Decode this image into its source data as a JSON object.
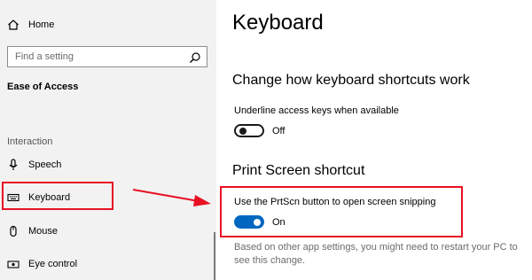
{
  "sidebar": {
    "home_label": "Home",
    "search_placeholder": "Find a setting",
    "section_title": "Ease of Access",
    "group_label": "Interaction",
    "items": [
      {
        "label": "Speech",
        "icon": "microphone-icon"
      },
      {
        "label": "Keyboard",
        "icon": "keyboard-icon"
      },
      {
        "label": "Mouse",
        "icon": "mouse-icon"
      },
      {
        "label": "Eye control",
        "icon": "eye-icon"
      }
    ]
  },
  "main": {
    "title": "Keyboard",
    "shortcuts_heading": "Change how keyboard shortcuts work",
    "underline_label": "Underline access keys when available",
    "underline_state": "Off",
    "printscreen_heading": "Print Screen shortcut",
    "prtscn_label": "Use the PrtScn button to open screen snipping",
    "prtscn_state": "On",
    "note": "Based on other app settings, you might need to restart your PC to see this change."
  },
  "colors": {
    "accent": "#0067c0",
    "highlight": "#e81123",
    "sidebar_bg": "#f2f2f2"
  }
}
